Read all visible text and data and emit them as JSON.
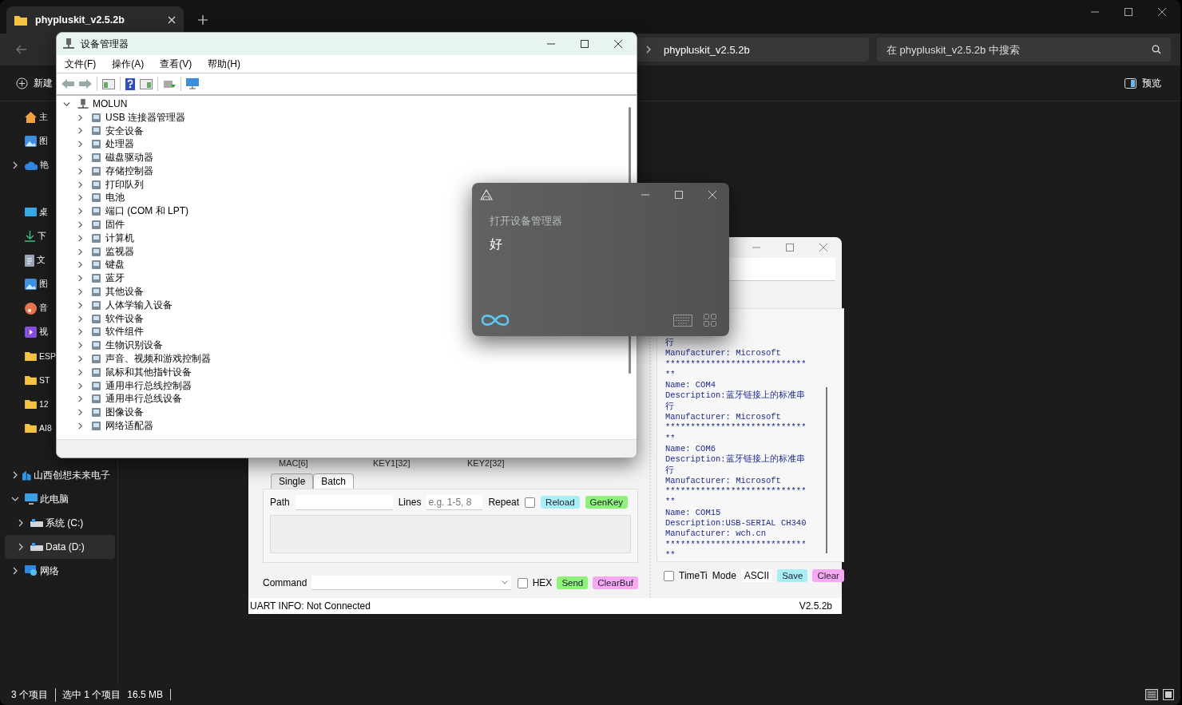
{
  "explorer": {
    "tab": {
      "title": "phypluskit_v2.5.2b"
    },
    "breadcrumb": "phypluskit_v2.5.2b",
    "search": {
      "placeholder": "在 phypluskit_v2.5.2b 中搜索"
    },
    "toolbar": {
      "new": "新建",
      "preview": "预览"
    },
    "sidebar": {
      "sections": [
        {
          "items": [
            {
              "label": "主",
              "kind": "home",
              "selected": false
            },
            {
              "label": "图",
              "kind": "gallery",
              "selected": false
            },
            {
              "label": "艳",
              "kind": "cloud",
              "selected": false,
              "expanded": false
            }
          ]
        },
        {
          "items": [
            {
              "label": "桌",
              "kind": "desktop",
              "selected": false
            },
            {
              "label": "下",
              "kind": "download",
              "selected": false
            },
            {
              "label": "文",
              "kind": "document",
              "selected": false
            },
            {
              "label": "图",
              "kind": "picture",
              "selected": false
            },
            {
              "label": "音",
              "kind": "music",
              "selected": false
            },
            {
              "label": "视",
              "kind": "video",
              "selected": false
            },
            {
              "label": "ESP",
              "kind": "folder",
              "selected": false
            },
            {
              "label": "ST",
              "kind": "folder",
              "selected": false
            },
            {
              "label": "12",
              "kind": "folder",
              "selected": false
            },
            {
              "label": "AI8",
              "kind": "folder",
              "selected": false
            }
          ]
        },
        {
          "items": [
            {
              "label": "山西创想未来电子",
              "kind": "org",
              "selected": false,
              "expanded": false
            },
            {
              "label": "此电脑",
              "kind": "pc",
              "selected": false,
              "expanded": true,
              "children": [
                {
                  "label": "系统 (C:)",
                  "kind": "drive",
                  "selected": false,
                  "expanded": false
                },
                {
                  "label": "Data (D:)",
                  "kind": "drive",
                  "selected": true,
                  "expanded": false
                }
              ]
            },
            {
              "label": "网络",
              "kind": "network",
              "selected": false,
              "expanded": false
            }
          ]
        }
      ]
    },
    "status_bar": [
      "3 个项目",
      "选中 1 个项目",
      "16.5 MB"
    ]
  },
  "device_manager": {
    "title": "设备管理器",
    "menu": [
      "文件(F)",
      "操作(A)",
      "查看(V)",
      "帮助(H)"
    ],
    "tree": {
      "label": "MOLUN",
      "expanded": true,
      "children": [
        {
          "label": "USB 连接器管理器",
          "expanded": false
        },
        {
          "label": "安全设备",
          "expanded": false
        },
        {
          "label": "处理器",
          "expanded": false
        },
        {
          "label": "磁盘驱动器",
          "expanded": false
        },
        {
          "label": "存储控制器",
          "expanded": false
        },
        {
          "label": "打印队列",
          "expanded": false
        },
        {
          "label": "电池",
          "expanded": false
        },
        {
          "label": "端口 (COM 和 LPT)",
          "expanded": false
        },
        {
          "label": "固件",
          "expanded": false
        },
        {
          "label": "计算机",
          "expanded": false
        },
        {
          "label": "监视器",
          "expanded": false
        },
        {
          "label": "键盘",
          "expanded": false
        },
        {
          "label": "蓝牙",
          "expanded": false
        },
        {
          "label": "其他设备",
          "expanded": false
        },
        {
          "label": "人体学输入设备",
          "expanded": false
        },
        {
          "label": "软件设备",
          "expanded": false
        },
        {
          "label": "软件组件",
          "expanded": false
        },
        {
          "label": "生物识别设备",
          "expanded": false
        },
        {
          "label": "声音、视频和游戏控制器",
          "expanded": false
        },
        {
          "label": "鼠标和其他指针设备",
          "expanded": false
        },
        {
          "label": "通用串行总线控制器",
          "expanded": false
        },
        {
          "label": "通用串行总线设备",
          "expanded": false
        },
        {
          "label": "图像设备",
          "expanded": false
        },
        {
          "label": "网络适配器",
          "expanded": false
        }
      ]
    }
  },
  "assistant": {
    "prompt": "打开设备管理器",
    "reply": "好"
  },
  "serial_tool": {
    "columns": [
      "MAC[6]",
      "KEY1[32]",
      "KEY2[32]"
    ],
    "tabs": [
      {
        "label": "Single",
        "selected": false
      },
      {
        "label": "Batch",
        "selected": true
      }
    ],
    "path": {
      "label": "Path"
    },
    "lines": {
      "label": "Lines",
      "placeholder": "e.g. 1-5, 8"
    },
    "repeat": {
      "label": "Repeat",
      "checked": false
    },
    "batch_buttons": [
      {
        "label": "Reload",
        "color": "#a8eef5"
      },
      {
        "label": "GenKey",
        "color": "#8df27a"
      }
    ],
    "command": {
      "label": "Command"
    },
    "hex": {
      "label": "HEX",
      "checked": false
    },
    "command_buttons": [
      {
        "label": "Send",
        "color": "#8df27a"
      },
      {
        "label": "ClearBuf",
        "color": "#f7a8f2"
      }
    ],
    "log": [
      "行",
      "Manufacturer: Microsoft",
      "****************************",
      "**",
      "Name: COM4",
      "Description:蓝牙链接上的标准串",
      "行",
      "Manufacturer: Microsoft",
      "****************************",
      "**",
      "Name: COM6",
      "Description:蓝牙链接上的标准串",
      "行",
      "Manufacturer: Microsoft",
      "****************************",
      "**",
      "Name: COM15",
      "Description:USB-SERIAL CH340",
      "Manufacturer: wch.cn",
      "****************************",
      "**"
    ],
    "timeti": {
      "label": "TimeTi",
      "checked": false
    },
    "mode": {
      "label": "Mode",
      "value": "ASCII"
    },
    "log_buttons": [
      {
        "label": "Save",
        "color": "#a8eef5"
      },
      {
        "label": "Clear",
        "color": "#f7a8f2"
      }
    ],
    "status": "UART INFO: Not Connected",
    "version": "V2.5.2b"
  }
}
